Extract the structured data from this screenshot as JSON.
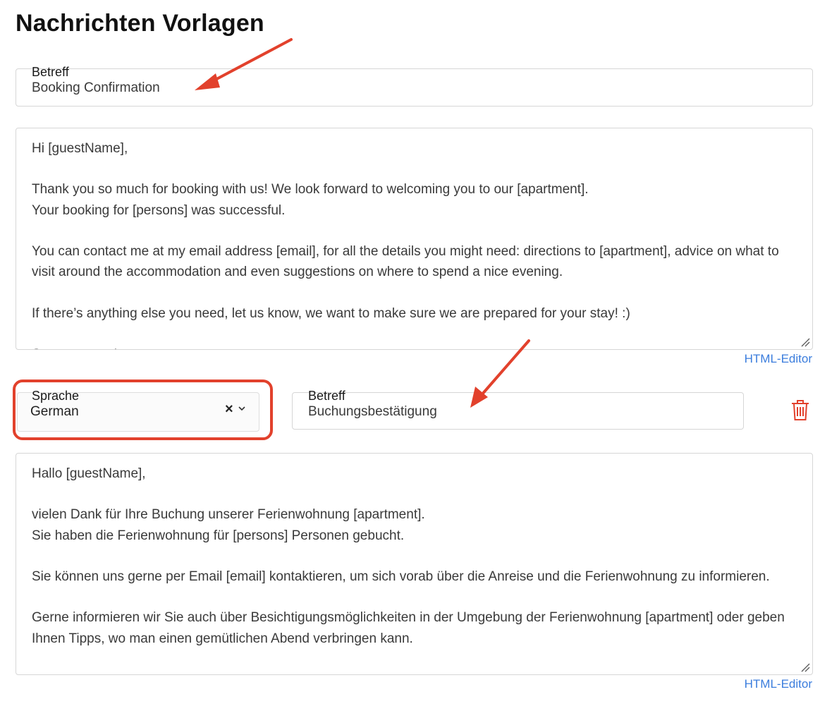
{
  "page": {
    "title": "Nachrichten Vorlagen"
  },
  "default_template": {
    "subject_label": "Betreff",
    "subject_value": "Booking Confirmation",
    "body": "Hi [guestName],\n\nThank you so much for booking with us! We look forward to welcoming you to our [apartment].\nYour booking for [persons] was successful.\n\nYou can contact me at my email address [email], for all the details you might need: directions to [apartment], advice on what to visit around the accommodation and even suggestions on where to spend a nice evening.\n\nIf there’s anything else you need, let us know, we want to make sure we are prepared for your stay! :)\n\nSee you soon!",
    "html_editor_label": "HTML-Editor"
  },
  "translation": {
    "language_label": "Sprache",
    "language_value": "German",
    "subject_label": "Betreff",
    "subject_value": "Buchungsbestätigung",
    "body": "Hallo [guestName],\n\nvielen Dank für Ihre Buchung unserer Ferienwohnung [apartment].\nSie haben die Ferienwohnung für [persons] Personen gebucht.\n\nSie können uns gerne per Email [email] kontaktieren, um sich vorab über die Anreise und die Ferienwohnung zu informieren.\n\nGerne informieren wir Sie auch über Besichtigungsmöglichkeiten in der Umgebung der Ferienwohnung [apartment] oder geben Ihnen Tipps, wo man einen gemütlichen Abend verbringen kann.",
    "html_editor_label": "HTML-Editor"
  },
  "icons": {
    "clear": "close-icon",
    "dropdown": "chevron-down-icon",
    "delete": "trash-icon",
    "resize": "resize-handle-icon"
  },
  "colors": {
    "link": "#3b7ddd",
    "annotation": "#e2412c",
    "delete_icon": "#e2412c",
    "border": "#d6d6d6"
  }
}
